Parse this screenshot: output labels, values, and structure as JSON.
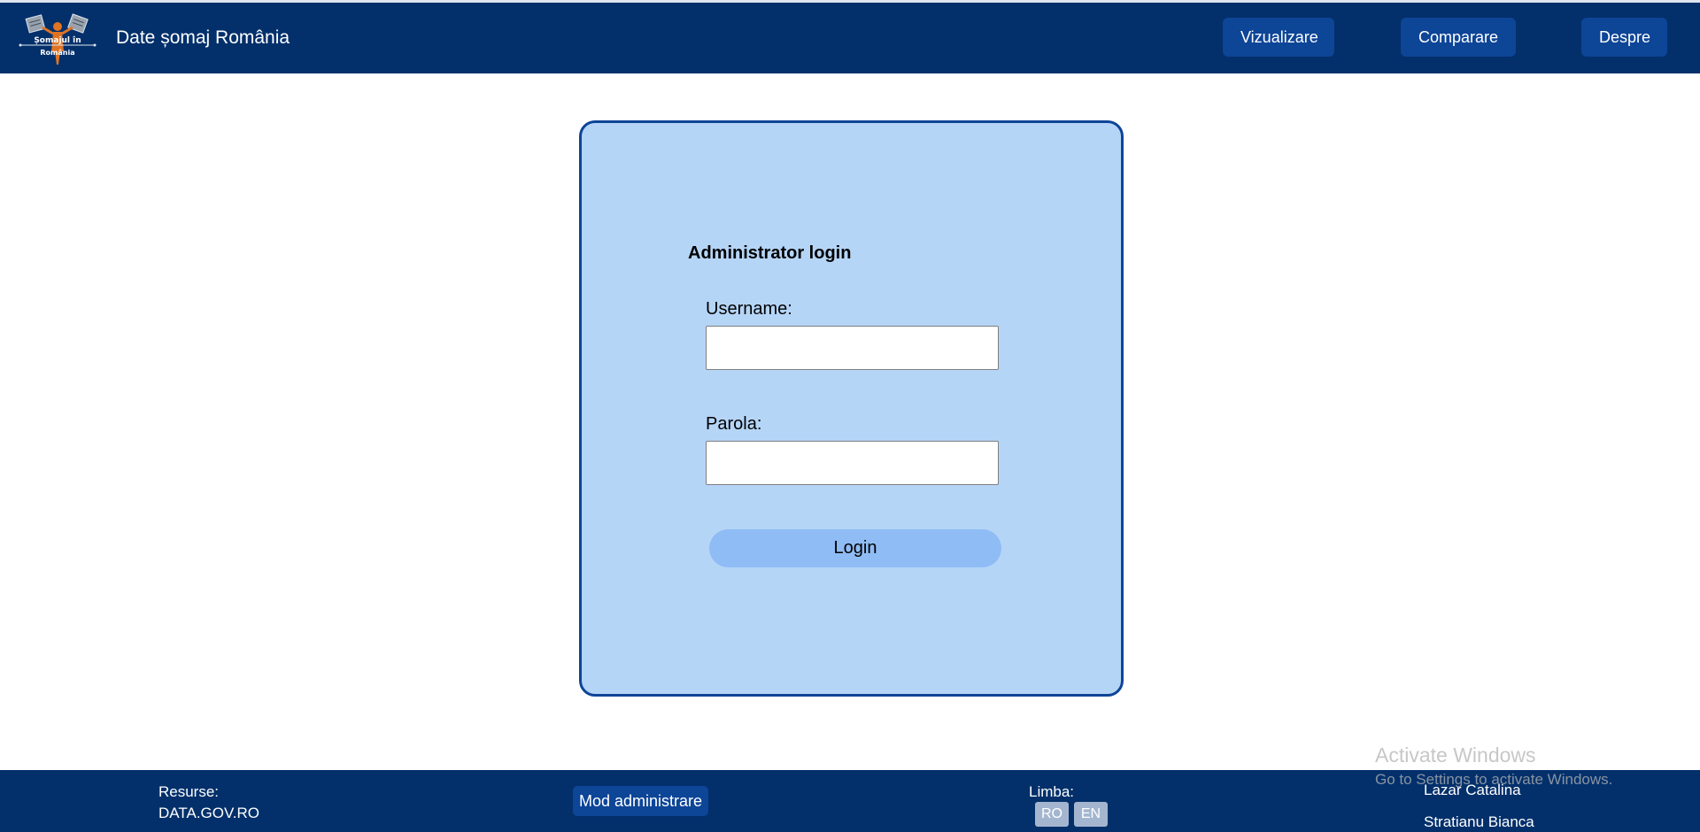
{
  "header": {
    "logo_icon": "somaj-logo-icon",
    "logo_text_line1": "Șomajul în",
    "logo_text_line2": "România",
    "title": "Date șomaj România",
    "nav": {
      "vizualizare": "Vizualizare",
      "comparare": "Comparare",
      "despre": "Despre"
    }
  },
  "login": {
    "heading": "Administrator login",
    "username_label": "Username:",
    "username_value": "",
    "password_label": "Parola:",
    "password_value": "",
    "button_label": "Login"
  },
  "footer": {
    "resurse_label": "Resurse:",
    "resurse_link": "DATA.GOV.RO",
    "admin_mode": "Mod administrare",
    "limba_label": "Limba:",
    "lang_ro": "RO",
    "lang_en": "EN",
    "author_1": "Lazar Catalina",
    "author_2": "Stratianu Bianca"
  },
  "watermark": {
    "title": "Activate Windows",
    "subtitle": "Go to Settings to activate Windows."
  },
  "colors": {
    "header_bg": "#03306b",
    "nav_button_bg": "#0d4597",
    "card_bg": "#b5d5f7",
    "card_border": "#0d4597",
    "login_button_bg": "#8fbcf5",
    "lang_button_bg": "#a4b6cf"
  }
}
